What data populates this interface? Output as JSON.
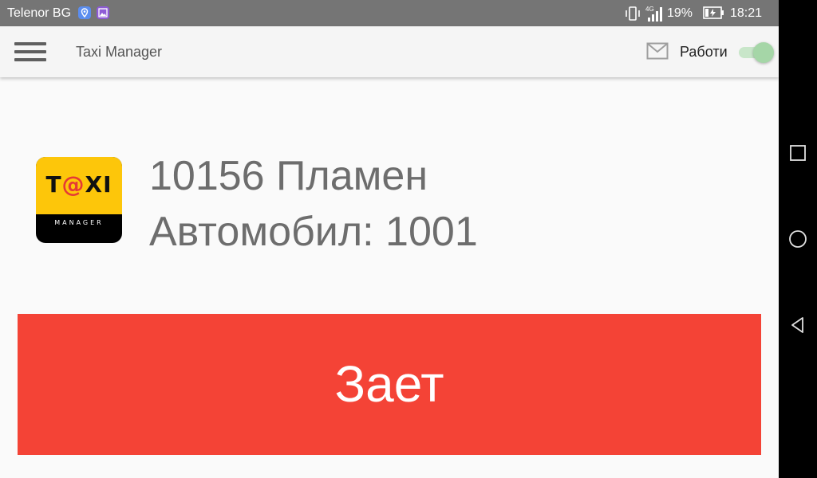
{
  "status_bar": {
    "carrier": "Telenor BG",
    "network": "4G",
    "battery_percent": "19%",
    "time": "18:21",
    "icons": [
      "location-icon",
      "gallery-icon",
      "vibrate-icon",
      "signal-icon",
      "battery-charging-icon"
    ]
  },
  "toolbar": {
    "menu_icon": "hamburger-menu-icon",
    "title": "Taxi Manager",
    "mail_icon": "mail-icon",
    "working_label": "Работи",
    "working_toggle_on": true
  },
  "logo": {
    "text_before_at": "T",
    "at": "@",
    "text_after_at": "XI",
    "subtitle": "MANAGER"
  },
  "driver": {
    "line1": "10156 Пламен",
    "line2": "Автомобил: 1001"
  },
  "status_button": {
    "label": "Зает",
    "color": "#f44336"
  },
  "nav_bar": {
    "icons": [
      "recent-apps-icon",
      "home-icon",
      "back-icon"
    ]
  },
  "colors": {
    "status_bar": "#757575",
    "toolbar": "#f5f5f5",
    "background": "#fafafa",
    "toggle_on": "#a5d6a7",
    "logo_yellow": "#fdc60a"
  }
}
